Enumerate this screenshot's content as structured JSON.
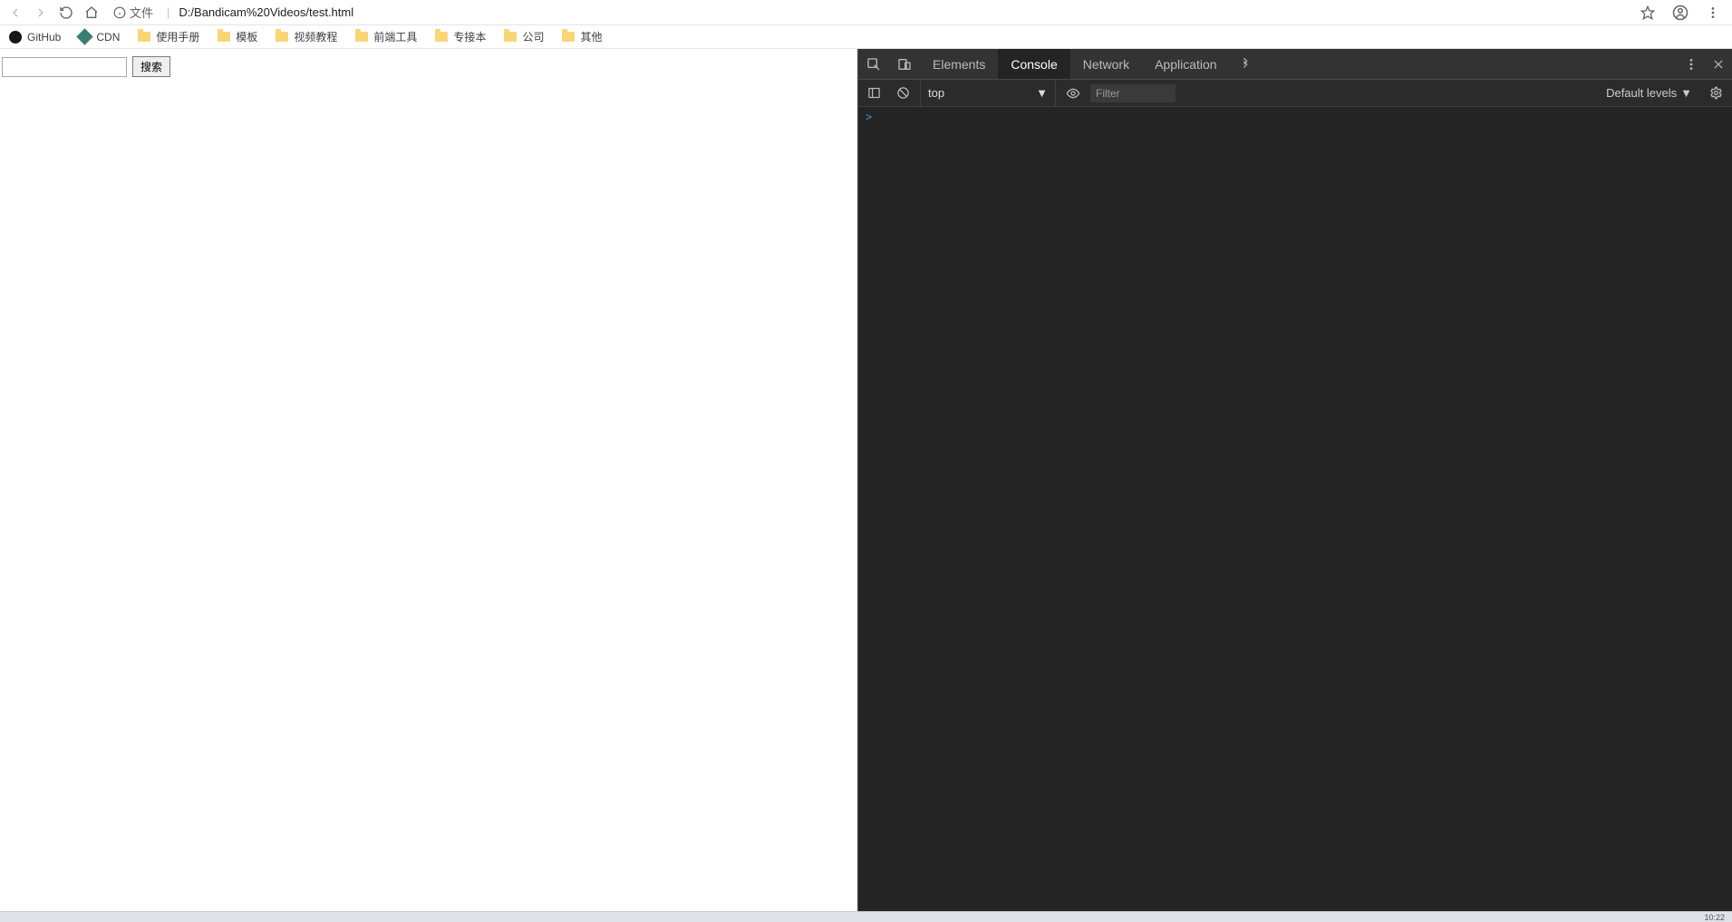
{
  "nav": {
    "file_label": "文件",
    "url": "D:/Bandicam%20Videos/test.html"
  },
  "bookmarks": [
    {
      "icon": "github",
      "label": "GitHub"
    },
    {
      "icon": "cdn",
      "label": "CDN"
    },
    {
      "icon": "folder",
      "label": "使用手册"
    },
    {
      "icon": "folder",
      "label": "模板"
    },
    {
      "icon": "folder",
      "label": "视频教程"
    },
    {
      "icon": "folder",
      "label": "前端工具"
    },
    {
      "icon": "folder",
      "label": "专接本"
    },
    {
      "icon": "folder",
      "label": "公司"
    },
    {
      "icon": "folder",
      "label": "其他"
    }
  ],
  "page": {
    "search_value": "",
    "search_button": "搜索"
  },
  "devtools": {
    "tabs": {
      "elements": "Elements",
      "console": "Console",
      "network": "Network",
      "application": "Application"
    },
    "toolbar": {
      "context": "top",
      "filter_placeholder": "Filter",
      "levels": "Default levels"
    },
    "prompt": ">"
  },
  "bottom": {
    "clock": "10:22"
  }
}
